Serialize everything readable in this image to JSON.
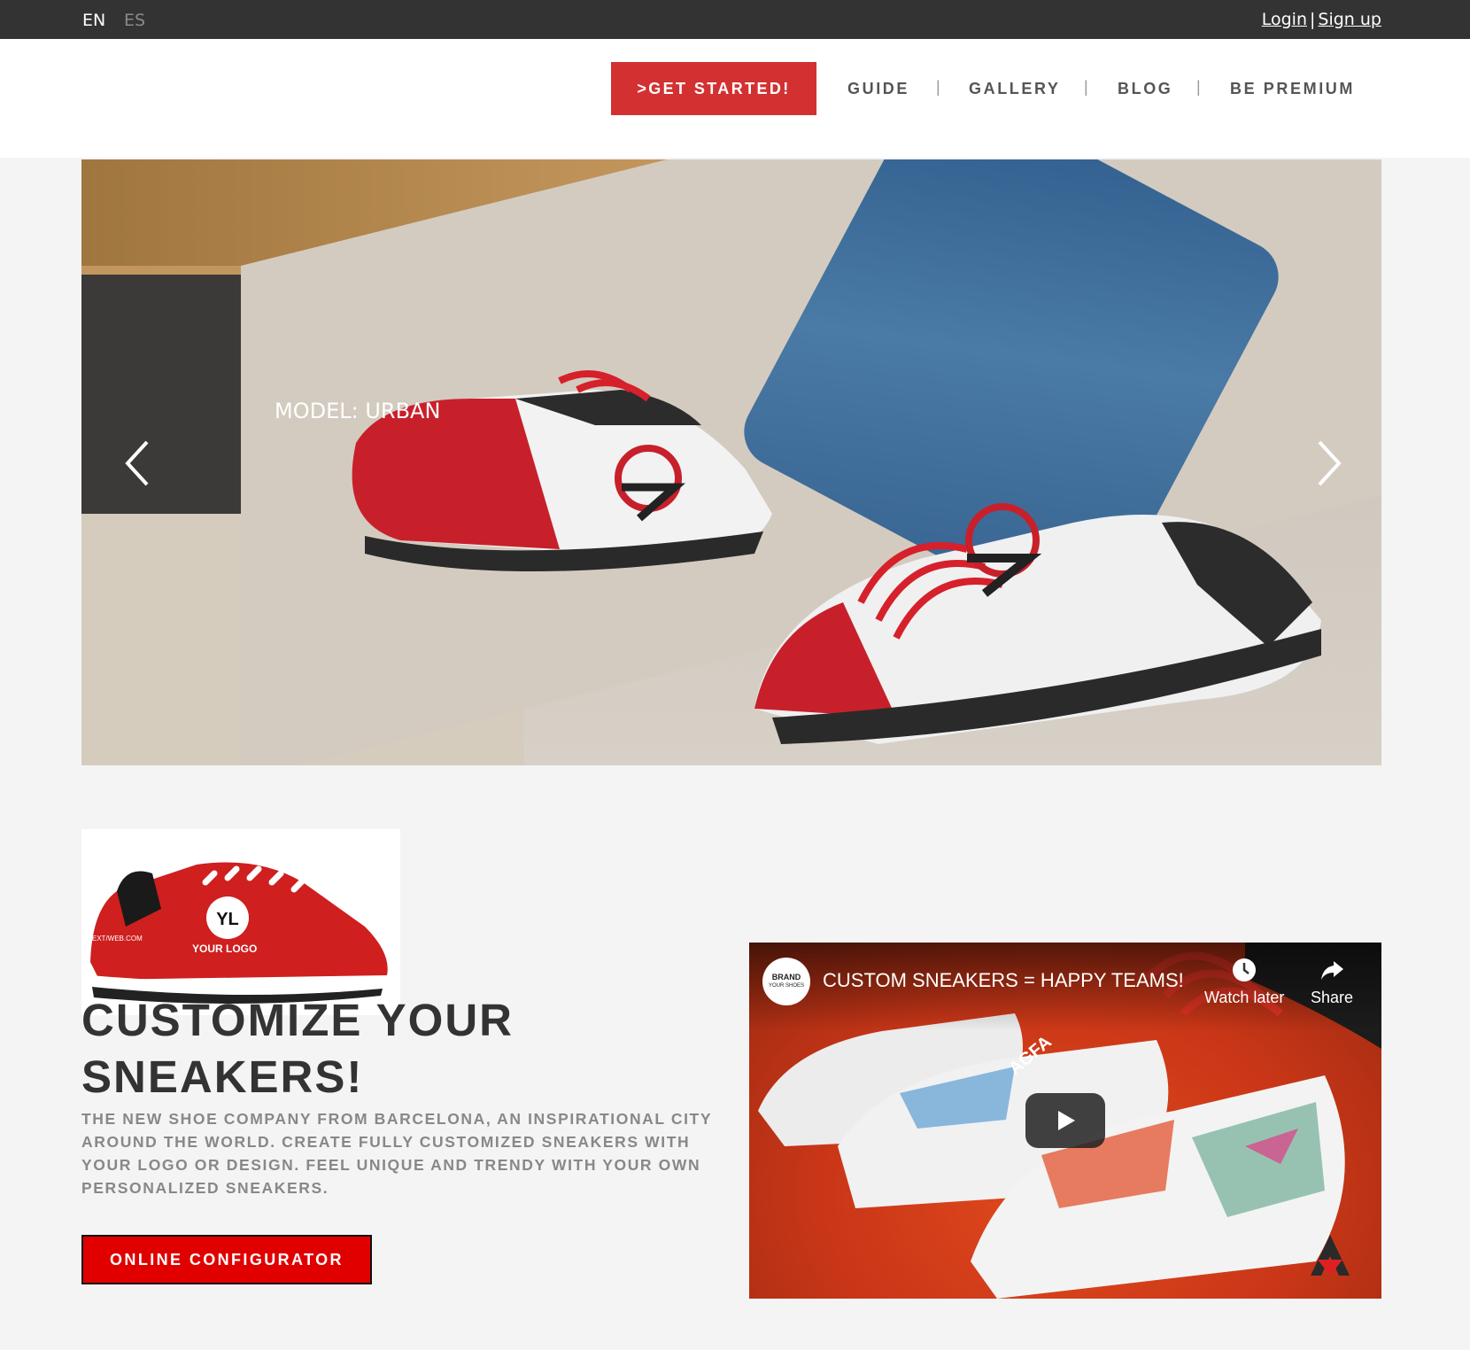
{
  "topbar": {
    "lang_en": "EN",
    "lang_es": "ES",
    "login": "Login",
    "separator": "|",
    "signup": "Sign up"
  },
  "header": {
    "cta": ">GET STARTED!",
    "nav": [
      "GUIDE",
      "GALLERY",
      "BLOG",
      "BE PREMIUM"
    ],
    "nav_separator": "|"
  },
  "hero": {
    "caption": "MODEL: URBAN"
  },
  "promo": {
    "thumbnail_text_logo": "YL",
    "thumbnail_text_your_logo": "YOUR LOGO",
    "thumbnail_text_web": "TEXT/WEB.COM",
    "title_line1": "CUSTOMIZE YOUR",
    "title_line2": "SNEAKERS!",
    "description": "THE NEW SHOE COMPANY FROM BARCELONA, AN INSPIRATIONAL CITY AROUND THE WORLD. CREATE FULLY CUSTOMIZED SNEAKERS WITH YOUR LOGO OR DESIGN. FEEL UNIQUE AND TRENDY WITH YOUR OWN PERSONALIZED SNEAKERS.",
    "button": "ONLINE CONFIGURATOR"
  },
  "video": {
    "channel_line1": "BRAND",
    "channel_line2": "YOUR SHOES",
    "title": "CUSTOM SNEAKERS = HAPPY TEAMS!",
    "watch_later": "Watch later",
    "share": "Share",
    "shoe_print": "AGFA"
  },
  "colors": {
    "accent_red": "#d33131",
    "button_red": "#e00000",
    "topbar": "#333333"
  }
}
